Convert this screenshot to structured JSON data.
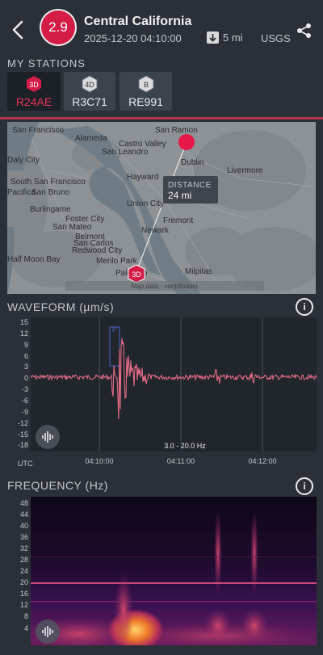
{
  "header": {
    "magnitude": "2.9",
    "title": "Central California",
    "datetime": "2025-12-20 04:10:00",
    "depth": "5 mi",
    "source": "USGS"
  },
  "my_stations": {
    "label": "MY STATIONS",
    "items": [
      {
        "badge": "3D",
        "code": "R24AE",
        "active": true,
        "color": "#d41c46"
      },
      {
        "badge": "4D",
        "code": "R3C71",
        "active": false,
        "color": "#9a9da3"
      },
      {
        "badge": "B",
        "code": "RE991",
        "active": false,
        "color": "#9a9da3"
      }
    ]
  },
  "map": {
    "places": [
      "San Francisco",
      "Alameda",
      "San Ramon",
      "San Leandro",
      "Daly City",
      "South San Francisco",
      "Castro Valley",
      "Hayward",
      "Dublin",
      "Livermore",
      "Pacifica",
      "San Bruno",
      "Union City",
      "Burlingame",
      "Foster City",
      "San Mateo",
      "Fremont",
      "Newark",
      "Belmont",
      "San Carlos",
      "Redwood City",
      "Menlo Park",
      "Half Moon Bay",
      "Milpitas",
      "Palo Alto"
    ],
    "distance_label": "DISTANCE",
    "distance_value": "24 mi",
    "station_badge": "3D",
    "attribution": "Map data · contributors"
  },
  "waveform": {
    "title": "WAVEFORM (µm/s)",
    "y_ticks": [
      "15",
      "12",
      "9",
      "6",
      "3",
      "0",
      "-3",
      "-6",
      "-9",
      "-12",
      "-15",
      "-18"
    ],
    "x_ticks": [
      "04:10:00",
      "04:11:00",
      "04:12:00"
    ],
    "utc_label": "UTC",
    "filter": "3.0 - 20.0 Hz",
    "marker": "P"
  },
  "frequency": {
    "title": "FREQUENCY (Hz)",
    "y_ticks": [
      "48",
      "44",
      "40",
      "36",
      "32",
      "28",
      "24",
      "20",
      "16",
      "12",
      "8",
      "4"
    ]
  },
  "colors": {
    "accent": "#d41c46",
    "wave": "#ef6f8a",
    "bg": "#2b3038"
  }
}
